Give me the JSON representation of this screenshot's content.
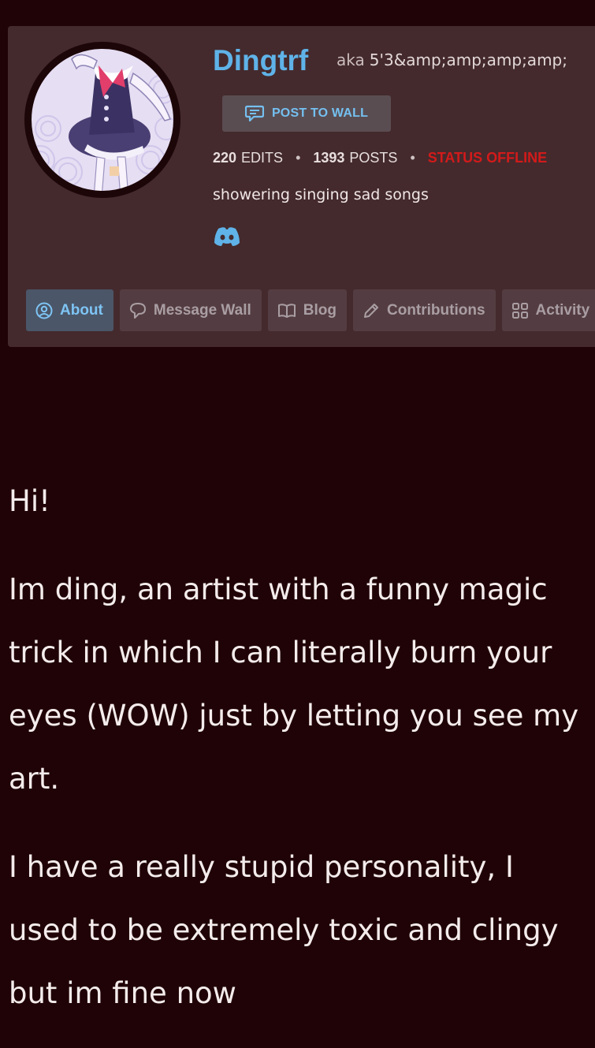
{
  "profile": {
    "username": "Dingtrf",
    "aka_label": "aka",
    "aka_value": "5'3&amp;amp;amp;amp;",
    "post_to_wall_label": "POST TO WALL",
    "stats": {
      "edits_count": "220",
      "edits_label": "EDITS",
      "posts_count": "1393",
      "posts_label": "POSTS",
      "status": "STATUS OFFLINE"
    },
    "bio": "showering singing sad songs",
    "social_icon": "discord-icon"
  },
  "tabs": [
    {
      "label": "About",
      "icon": "user-circle-icon",
      "active": true
    },
    {
      "label": "Message Wall",
      "icon": "speech-bubble-icon",
      "active": false
    },
    {
      "label": "Blog",
      "icon": "book-icon",
      "active": false
    },
    {
      "label": "Contributions",
      "icon": "pencil-icon",
      "active": false
    },
    {
      "label": "Activity",
      "icon": "grid-icon",
      "active": false
    }
  ],
  "about": {
    "paragraphs": [
      "Hi!",
      "Im ding, an artist with a funny magic trick in which I can literally burn your eyes (WOW) just by letting you see my art.",
      "I have a really stupid personality, I used to be extremely toxic and clingy but im fine now"
    ]
  },
  "colors": {
    "background": "#200306",
    "card": "#442a2d",
    "accent": "#5fb3e8",
    "status_offline": "#d31a1a"
  }
}
